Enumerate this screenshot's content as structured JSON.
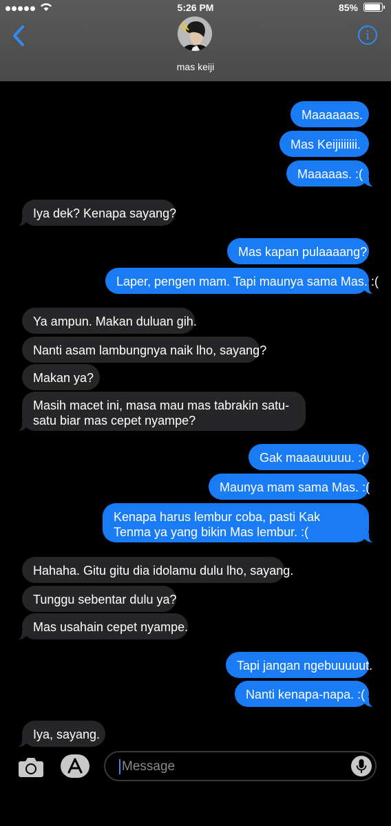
{
  "status_bar": {
    "time": "5:26 PM",
    "battery": "85%",
    "battery_level": 0.85
  },
  "header": {
    "contact_name": "mas keiji",
    "back_icon": "chevron-left-icon",
    "info_icon": "info-icon"
  },
  "messages": [
    {
      "from": "me",
      "text": "Maaaaaas."
    },
    {
      "from": "me",
      "text": "Mas Keijiiiiiii."
    },
    {
      "from": "me",
      "text": "Maaaaas. :("
    },
    {
      "from": "them",
      "text": "Iya dek? Kenapa sayang?"
    },
    {
      "from": "me",
      "text": "Mas kapan pulaaaang?"
    },
    {
      "from": "me",
      "text": "Laper, pengen mam. Tapi maunya sama Mas. :("
    },
    {
      "from": "them",
      "text": "Ya ampun. Makan duluan gih."
    },
    {
      "from": "them",
      "text": "Nanti asam lambungnya naik lho, sayang?"
    },
    {
      "from": "them",
      "text": "Makan ya?"
    },
    {
      "from": "them",
      "text": "Masih macet ini, masa mau mas tabrakin satu-satu biar mas cepet nyampe?"
    },
    {
      "from": "me",
      "text": "Gak maaauuuuu. :("
    },
    {
      "from": "me",
      "text": "Maunya mam sama Mas. :("
    },
    {
      "from": "me",
      "text": "Kenapa harus lembur coba, pasti Kak Tenma ya yang bikin Mas lembur. :("
    },
    {
      "from": "them",
      "text": "Hahaha. Gitu gitu dia idolamu dulu lho, sayang."
    },
    {
      "from": "them",
      "text": "Tunggu sebentar dulu ya?"
    },
    {
      "from": "them",
      "text": "Mas usahain cepet nyampe."
    },
    {
      "from": "me",
      "text": "Tapi jangan ngebuuuuut."
    },
    {
      "from": "me",
      "text": "Nanti kenapa-napa. :("
    },
    {
      "from": "them",
      "text": "Iya, sayang."
    }
  ],
  "composer": {
    "placeholder": "Message",
    "camera_icon": "camera-icon",
    "apps_icon": "app-store-icon",
    "mic_icon": "microphone-icon"
  },
  "colors": {
    "outgoing": "#1a7cf5",
    "incoming": "#262628",
    "accent": "#2f8cf5"
  }
}
